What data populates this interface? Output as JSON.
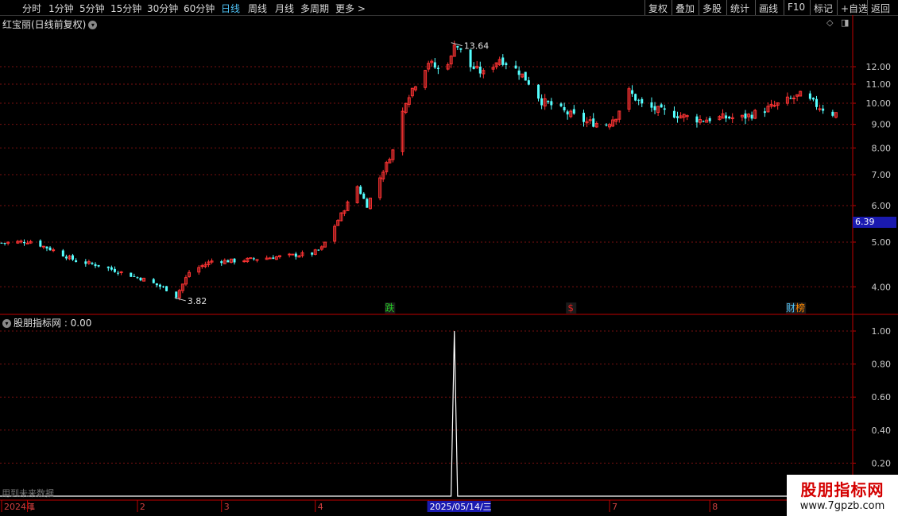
{
  "toolbar": {
    "left_items": [
      "分时",
      "1分钟",
      "5分钟",
      "15分钟",
      "30分钟",
      "60分钟",
      "日线",
      "周线",
      "月线",
      "多周期",
      "更多 >"
    ],
    "active_item": "日线",
    "right_items": [
      "复权",
      "叠加",
      "多股",
      "统计",
      "画线",
      "F10",
      "标记",
      "+自选",
      "返回"
    ]
  },
  "main_chart": {
    "title": "红宝丽(日线前复权)",
    "high_label": "13.64",
    "low_label": "3.82",
    "current_price": "6.39",
    "markers": [
      {
        "text": "跌",
        "color": "#22cc22",
        "x": "2025-04-24"
      },
      {
        "text": "$",
        "color": "#dd2222",
        "x": "2025-06-19"
      },
      {
        "text": "财",
        "color": "#4fc3f7",
        "x": "2025-08-26"
      },
      {
        "text": "榜",
        "color": "#ff8800",
        "x": "2025-08-29"
      }
    ]
  },
  "indicator": {
    "title": "股朋指标网 : 0.00",
    "footnote": "用到未来数据"
  },
  "time_axis": {
    "labels": [
      "2024年",
      "1",
      "2",
      "3",
      "4",
      "5",
      "7",
      "8"
    ],
    "highlight": "2025/05/14/三"
  },
  "watermark": {
    "line1": "股朋指标网",
    "line2": "www.7gpzb.com"
  },
  "chart_data": [
    {
      "type": "candlestick",
      "title": "红宝丽(日线前复权)",
      "y_ticks": [
        "12.00",
        "11.00",
        "10.00",
        "9.00",
        "8.00",
        "7.00",
        "6.00",
        "5.00",
        "4.00"
      ],
      "ylim": [
        3.5,
        14.4
      ],
      "log_scale": true,
      "grid": true,
      "colors": {
        "up": "#ff3333",
        "down": "#54ffff",
        "grid": "#7a1010"
      },
      "price_series": [
        [
          "2024-12-25",
          4.98
        ],
        [
          "2025-01-03",
          5.02
        ],
        [
          "2025-01-10",
          4.8
        ],
        [
          "2025-01-17",
          4.55
        ],
        [
          "2025-01-24",
          4.45
        ],
        [
          "2025-02-07",
          4.15
        ],
        [
          "2025-02-14",
          3.95
        ],
        [
          "2025-02-17",
          3.82
        ],
        [
          "2025-02-21",
          4.3
        ],
        [
          "2025-02-28",
          4.55
        ],
        [
          "2025-03-07",
          4.55
        ],
        [
          "2025-03-14",
          4.6
        ],
        [
          "2025-03-21",
          4.65
        ],
        [
          "2025-03-31",
          4.72
        ],
        [
          "2025-04-03",
          4.85
        ],
        [
          "2025-04-10",
          5.9
        ],
        [
          "2025-04-14",
          6.6
        ],
        [
          "2025-04-17",
          6.0
        ],
        [
          "2025-04-21",
          6.9
        ],
        [
          "2025-04-25",
          7.9
        ],
        [
          "2025-04-29",
          10.2
        ],
        [
          "2025-05-06",
          12.3
        ],
        [
          "2025-05-09",
          11.8
        ],
        [
          "2025-05-13",
          12.5
        ],
        [
          "2025-05-14",
          13.6
        ],
        [
          "2025-05-19",
          12.0
        ],
        [
          "2025-05-23",
          11.6
        ],
        [
          "2025-05-28",
          12.5
        ],
        [
          "2025-06-03",
          11.7
        ],
        [
          "2025-06-06",
          11.1
        ],
        [
          "2025-06-10",
          10.1
        ],
        [
          "2025-06-13",
          9.9
        ],
        [
          "2025-06-18",
          9.5
        ],
        [
          "2025-06-24",
          9.1
        ],
        [
          "2025-06-30",
          9.0
        ],
        [
          "2025-07-03",
          9.4
        ],
        [
          "2025-07-07",
          10.6
        ],
        [
          "2025-07-11",
          9.9
        ],
        [
          "2025-07-17",
          9.6
        ],
        [
          "2025-07-23",
          9.4
        ],
        [
          "2025-07-29",
          9.2
        ],
        [
          "2025-08-04",
          9.3
        ],
        [
          "2025-08-11",
          9.3
        ],
        [
          "2025-08-15",
          9.5
        ],
        [
          "2025-08-20",
          9.8
        ],
        [
          "2025-08-26",
          10.2
        ],
        [
          "2025-08-29",
          10.4
        ],
        [
          "2025-09-03",
          9.9
        ],
        [
          "2025-09-08",
          9.5
        ]
      ]
    },
    {
      "type": "line",
      "title": "股朋指标网",
      "y_ticks": [
        "1.00",
        "0.80",
        "0.60",
        "0.40",
        "0.20"
      ],
      "ylim": [
        0,
        1.0
      ],
      "grid": true,
      "x": [
        "2025-05-12",
        "2025-05-13",
        "2025-05-14",
        "2025-05-15",
        "2025-05-16"
      ],
      "values": [
        0,
        0,
        1,
        0,
        0
      ]
    }
  ]
}
